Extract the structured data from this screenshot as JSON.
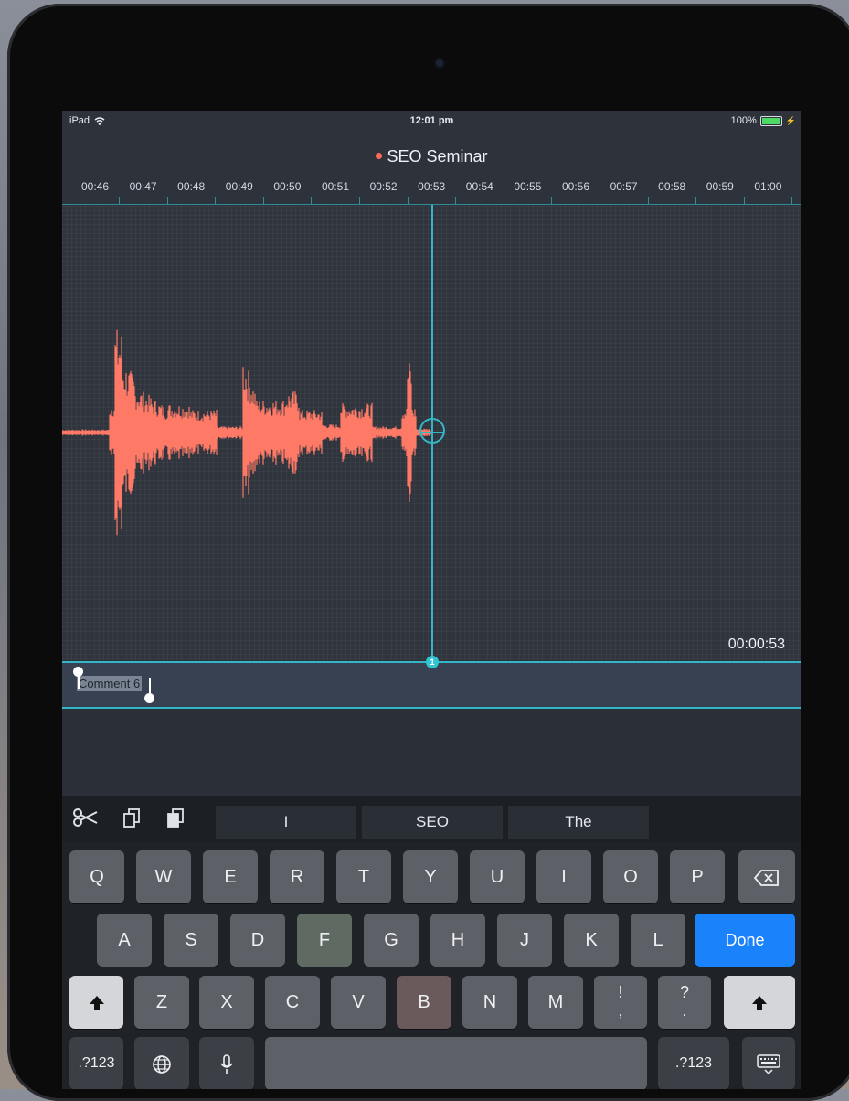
{
  "status_bar": {
    "device": "iPad",
    "time": "12:01 pm",
    "battery": "100%"
  },
  "recording": {
    "title": "SEO  Seminar",
    "elapsed": "00:00:53"
  },
  "timeline": {
    "labels": [
      "00:46",
      "00:47",
      "00:48",
      "00:49",
      "00:50",
      "00:51",
      "00:52",
      "00:53",
      "00:54",
      "00:55",
      "00:56",
      "00:57",
      "00:58",
      "00:59",
      "01:00"
    ]
  },
  "marker": {
    "number": "1",
    "comment": "Comment 6"
  },
  "keyboard": {
    "suggestions": [
      "I",
      "SEO",
      "The"
    ],
    "row1": [
      "Q",
      "W",
      "E",
      "R",
      "T",
      "Y",
      "U",
      "I",
      "O",
      "P"
    ],
    "row2": [
      "A",
      "S",
      "D",
      "F",
      "G",
      "H",
      "J",
      "K",
      "L"
    ],
    "row3": [
      "Z",
      "X",
      "C",
      "V",
      "B",
      "N",
      "M"
    ],
    "punct1": {
      "top": "!",
      "bottom": ","
    },
    "punct2": {
      "top": "?",
      "bottom": "."
    },
    "done": "Done",
    "numbers_left": ".?123",
    "numbers_right": ".?123"
  },
  "icons": {
    "cut": "scissors-icon",
    "copy": "copy-icon",
    "paste": "paste-icon",
    "backspace": "backspace-icon",
    "shift": "shift-icon",
    "globe": "globe-icon",
    "mic": "microphone-icon",
    "hide": "keyboard-hide-icon",
    "wifi": "wifi-icon"
  },
  "colors": {
    "accent": "#33b7c7",
    "waveform": "#ff7a66",
    "done": "#1a82fb",
    "record_dot": "#ff6b5a"
  }
}
